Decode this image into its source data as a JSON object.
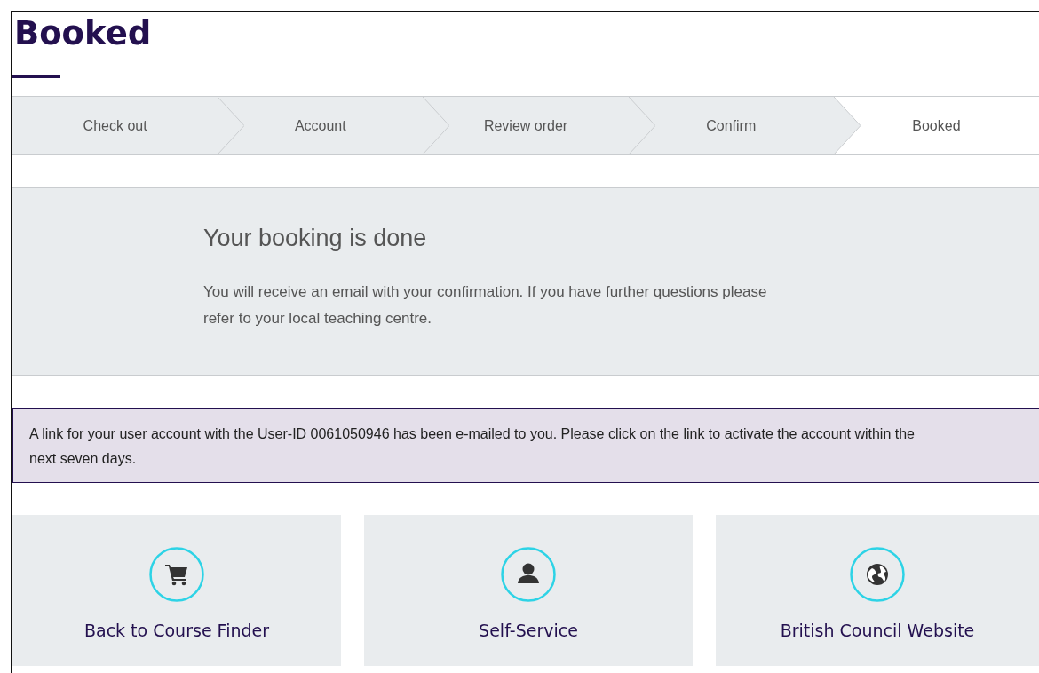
{
  "title": "Booked",
  "steps": [
    {
      "label": "Check out",
      "selected": false
    },
    {
      "label": "Account",
      "selected": false
    },
    {
      "label": "Review order",
      "selected": false
    },
    {
      "label": "Confirm",
      "selected": false
    },
    {
      "label": "Booked",
      "selected": true
    }
  ],
  "confirmation": {
    "heading": "Your booking is done",
    "text": "You will receive an email with your confirmation. If you have further questions please refer to your local teaching centre."
  },
  "notice": "A link for your user account with the User-ID 0061050946 has been e-mailed to you. Please click on the link to activate the account within the next seven days.",
  "links": [
    {
      "kind": "cart",
      "label": "Back to Course Finder"
    },
    {
      "kind": "person",
      "label": "Self-Service"
    },
    {
      "kind": "globe",
      "label": "British Council Website"
    }
  ]
}
